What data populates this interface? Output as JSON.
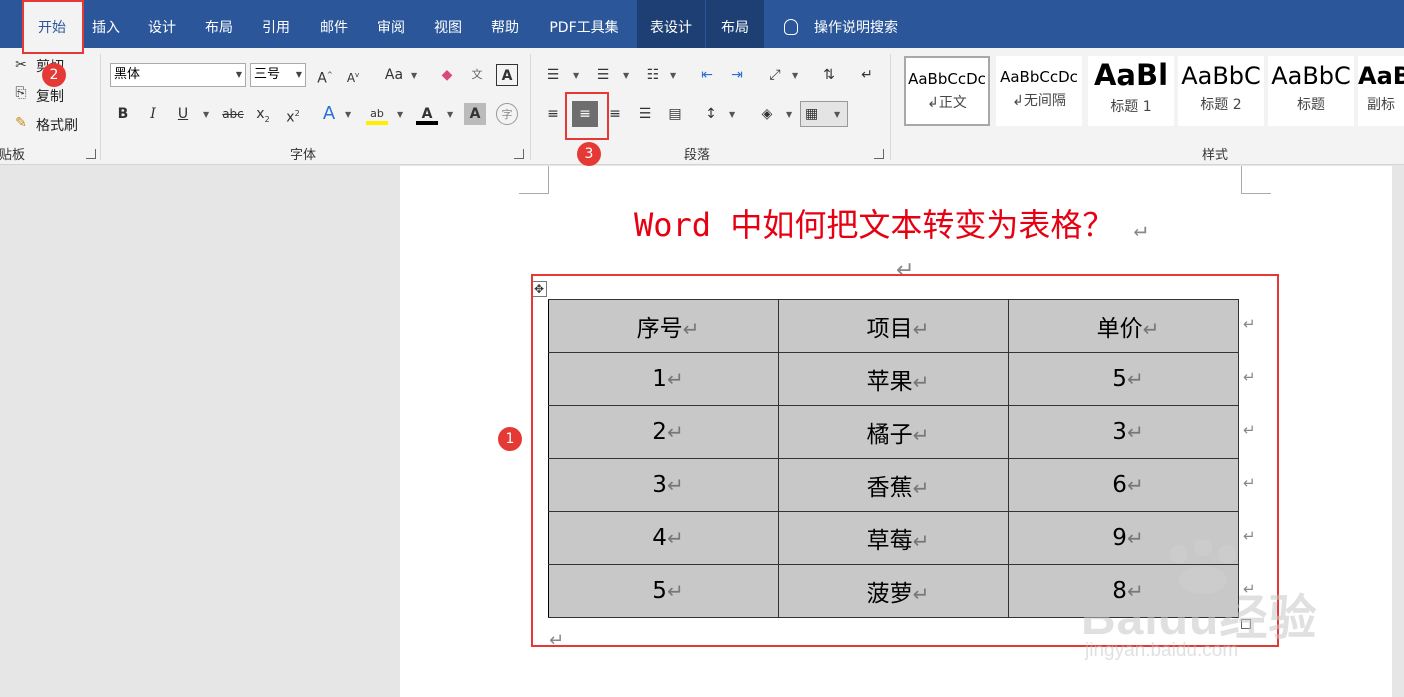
{
  "tabs": [
    {
      "label": "开始"
    },
    {
      "label": "插入"
    },
    {
      "label": "设计"
    },
    {
      "label": "布局"
    },
    {
      "label": "引用"
    },
    {
      "label": "邮件"
    },
    {
      "label": "审阅"
    },
    {
      "label": "视图"
    },
    {
      "label": "帮助"
    },
    {
      "label": "PDF工具集"
    },
    {
      "label": "表设计"
    },
    {
      "label": "布局"
    }
  ],
  "tell_me": "操作说明搜索",
  "clipboard": {
    "cut": "剪切",
    "copy": "复制",
    "format_painter": "格式刷",
    "label": "剪贴板"
  },
  "font": {
    "name": "黑体",
    "size": "三号",
    "label": "字体"
  },
  "paragraph": {
    "label": "段落"
  },
  "styles": {
    "label": "样式",
    "items": [
      {
        "sample": "AaBbCcDc",
        "name": "↲正文"
      },
      {
        "sample": "AaBbCcDc",
        "name": "↲无间隔"
      },
      {
        "sample": "AaBl",
        "name": "标题 1"
      },
      {
        "sample": "AaBbC",
        "name": "标题 2"
      },
      {
        "sample": "AaBbC",
        "name": "标题"
      },
      {
        "sample": "AaB",
        "name": "副标"
      }
    ]
  },
  "document": {
    "title": "Word 中如何把文本转变为表格？",
    "para_mark": "↵",
    "table": {
      "headers": [
        "序号",
        "项目",
        "单价"
      ],
      "rows": [
        [
          "1",
          "苹果",
          "5"
        ],
        [
          "2",
          "橘子",
          "3"
        ],
        [
          "3",
          "香蕉",
          "6"
        ],
        [
          "4",
          "草莓",
          "9"
        ],
        [
          "5",
          "菠萝",
          "8"
        ]
      ]
    }
  },
  "annotations": {
    "b1": "1",
    "b2": "2",
    "b3": "3"
  },
  "watermark": {
    "brand": "Baidu经验",
    "url": "jingyan.baidu.com"
  },
  "colors": {
    "ribbon_blue": "#2b579a",
    "annot_red": "#e53935",
    "title_red": "#e60012"
  }
}
